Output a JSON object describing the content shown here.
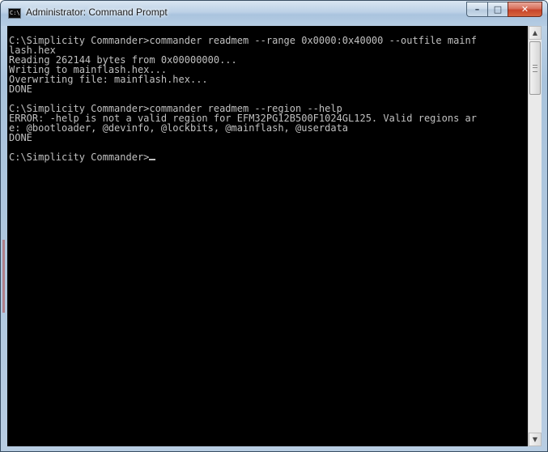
{
  "window": {
    "title": "Administrator: Command Prompt",
    "icon": "cmd-icon",
    "icon_glyph": "C:\\"
  },
  "caption_buttons": {
    "minimize": "–",
    "maximize": "□",
    "close": "✕"
  },
  "scrollbar": {
    "up_arrow": "▲",
    "down_arrow": "▼",
    "position": 0.0
  },
  "console": {
    "lines": [
      "",
      "C:\\Simplicity Commander>commander readmem --range 0x0000:0x40000 --outfile mainf",
      "lash.hex",
      "Reading 262144 bytes from 0x00000000...",
      "Writing to mainflash.hex...",
      "Overwriting file: mainflash.hex...",
      "DONE",
      "",
      "C:\\Simplicity Commander>commander readmem --region --help",
      "ERROR: -help is not a valid region for EFM32PG12B500F1024GL125. Valid regions ar",
      "e: @bootloader, @devinfo, @lockbits, @mainflash, @userdata",
      "DONE",
      "",
      "C:\\Simplicity Commander>"
    ],
    "colors": {
      "background": "#000000",
      "foreground": "#c0c0c0"
    }
  }
}
